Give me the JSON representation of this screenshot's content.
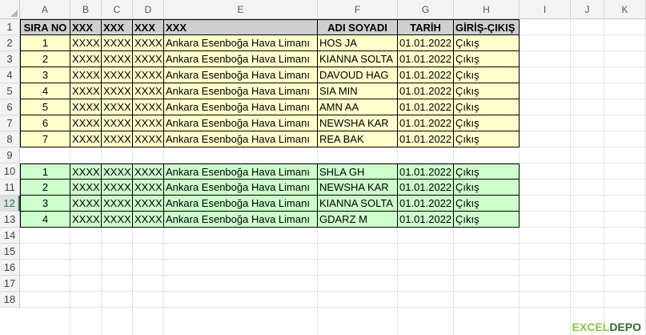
{
  "columns": [
    "A",
    "B",
    "C",
    "D",
    "E",
    "F",
    "G",
    "H",
    "I",
    "J",
    "K"
  ],
  "rows": [
    "1",
    "2",
    "3",
    "4",
    "5",
    "6",
    "7",
    "8",
    "9",
    "10",
    "11",
    "12",
    "13",
    "14",
    "15",
    "16",
    "17",
    "18"
  ],
  "selected_row": "12",
  "header": [
    "SIRA NO",
    "XXX",
    "XXX",
    "XXX",
    "XXX",
    "ADI SOYADI",
    "TARİH",
    "GİRİŞ-ÇIKIŞ"
  ],
  "table1": [
    [
      "1",
      "XXXX",
      "XXXX",
      "XXXX",
      "Ankara Esenboğa Hava Limanı",
      "HOS JA",
      "01.01.2022",
      "Çıkış"
    ],
    [
      "2",
      "XXXX",
      "XXXX",
      "XXXX",
      "Ankara Esenboğa Hava Limanı",
      "KIANNA SOLTA",
      "01.01.2022",
      "Çıkış"
    ],
    [
      "3",
      "XXXX",
      "XXXX",
      "XXXX",
      "Ankara Esenboğa Hava Limanı",
      "DAVOUD HAG",
      "01.01.2022",
      "Çıkış"
    ],
    [
      "4",
      "XXXX",
      "XXXX",
      "XXXX",
      "Ankara Esenboğa Hava Limanı",
      "SIA MIN",
      "01.01.2022",
      "Çıkış"
    ],
    [
      "5",
      "XXXX",
      "XXXX",
      "XXXX",
      "Ankara Esenboğa Hava Limanı",
      "AMN AA",
      "01.01.2022",
      "Çıkış"
    ],
    [
      "6",
      "XXXX",
      "XXXX",
      "XXXX",
      "Ankara Esenboğa Hava Limanı",
      "NEWSHA KAR",
      "01.01.2022",
      "Çıkış"
    ],
    [
      "7",
      "XXXX",
      "XXXX",
      "XXXX",
      "Ankara Esenboğa Hava Limanı",
      "REA BAK",
      "01.01.2022",
      "Çıkış"
    ]
  ],
  "table2": [
    [
      "1",
      "XXXX",
      "XXXX",
      "XXXX",
      "Ankara Esenboğa Hava Limanı",
      "SHLA GH",
      "01.01.2022",
      "Çıkış"
    ],
    [
      "2",
      "XXXX",
      "XXXX",
      "XXXX",
      "Ankara Esenboğa Hava Limanı",
      "NEWSHA KAR",
      "01.01.2022",
      "Çıkış"
    ],
    [
      "3",
      "XXXX",
      "XXXX",
      "XXXX",
      "Ankara Esenboğa Hava Limanı",
      "KIANNA SOLTA",
      "01.01.2022",
      "Çıkış"
    ],
    [
      "4",
      "XXXX",
      "XXXX",
      "XXXX",
      "Ankara Esenboğa Hava Limanı",
      "GDARZ M",
      "01.01.2022",
      "Çıkış"
    ]
  ],
  "logo": {
    "part1": "EXCEL",
    "part2": "DEPO"
  },
  "colors": {
    "header_fill": "#d0cece",
    "table1_fill": "#ffffcc",
    "table2_fill": "#ccffcc",
    "accent": "#217346"
  }
}
